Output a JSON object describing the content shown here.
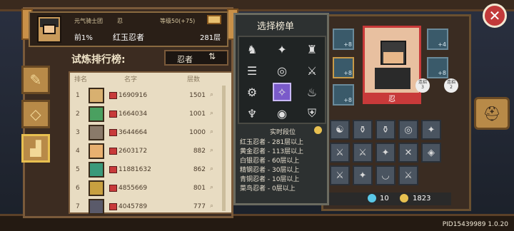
{
  "user": {
    "guild": "元气骑士团",
    "tag": "忍",
    "level": "等级50(+75)",
    "rank": "前1%",
    "title": "红玉忍者",
    "floor": "281层"
  },
  "trial": {
    "title": "试炼排行榜:",
    "selected": "忍者",
    "toggle_icon": "⇅"
  },
  "table": {
    "headers": {
      "rank": "排名",
      "name": "名字",
      "floor": "层数"
    },
    "rows": [
      {
        "rank": "1",
        "id": "1690916",
        "floor": "1501"
      },
      {
        "rank": "2",
        "id": "1664034",
        "floor": "1001"
      },
      {
        "rank": "3",
        "id": "3644664",
        "floor": "1000"
      },
      {
        "rank": "4",
        "id": "2603172",
        "floor": "882"
      },
      {
        "rank": "5",
        "id": "11881632",
        "floor": "862"
      },
      {
        "rank": "6",
        "id": "4855669",
        "floor": "801"
      },
      {
        "rank": "7",
        "id": "4045789",
        "floor": "777"
      }
    ]
  },
  "popup": {
    "title": "选择榜单",
    "realtime": "实时段位",
    "ranks": [
      "红玉忍者 - 281层以上",
      "黄金忍者 - 113层以上",
      "白银忍者 - 60层以上",
      "精钢忍者 - 30层以上",
      "青铜忍者 - 10层以上",
      "菜鸟忍者 - 0层以上"
    ]
  },
  "hero": {
    "name": "忍",
    "badge_left_top": "连招",
    "badge_left_bot": "3",
    "badge_right_top": "连招",
    "badge_right_bot": "2"
  },
  "slots": {
    "s1": "+8",
    "s2": "+8",
    "s3": "+8",
    "s4": "+8",
    "s5": "+4"
  },
  "currency": {
    "gems": "10",
    "coins": "1823"
  },
  "footer": {
    "pid": "PID15439989 1.0.20"
  },
  "colors": {
    "accent": "#c83a3a",
    "panel": "#3c2c21",
    "select": "#7a5aca"
  }
}
